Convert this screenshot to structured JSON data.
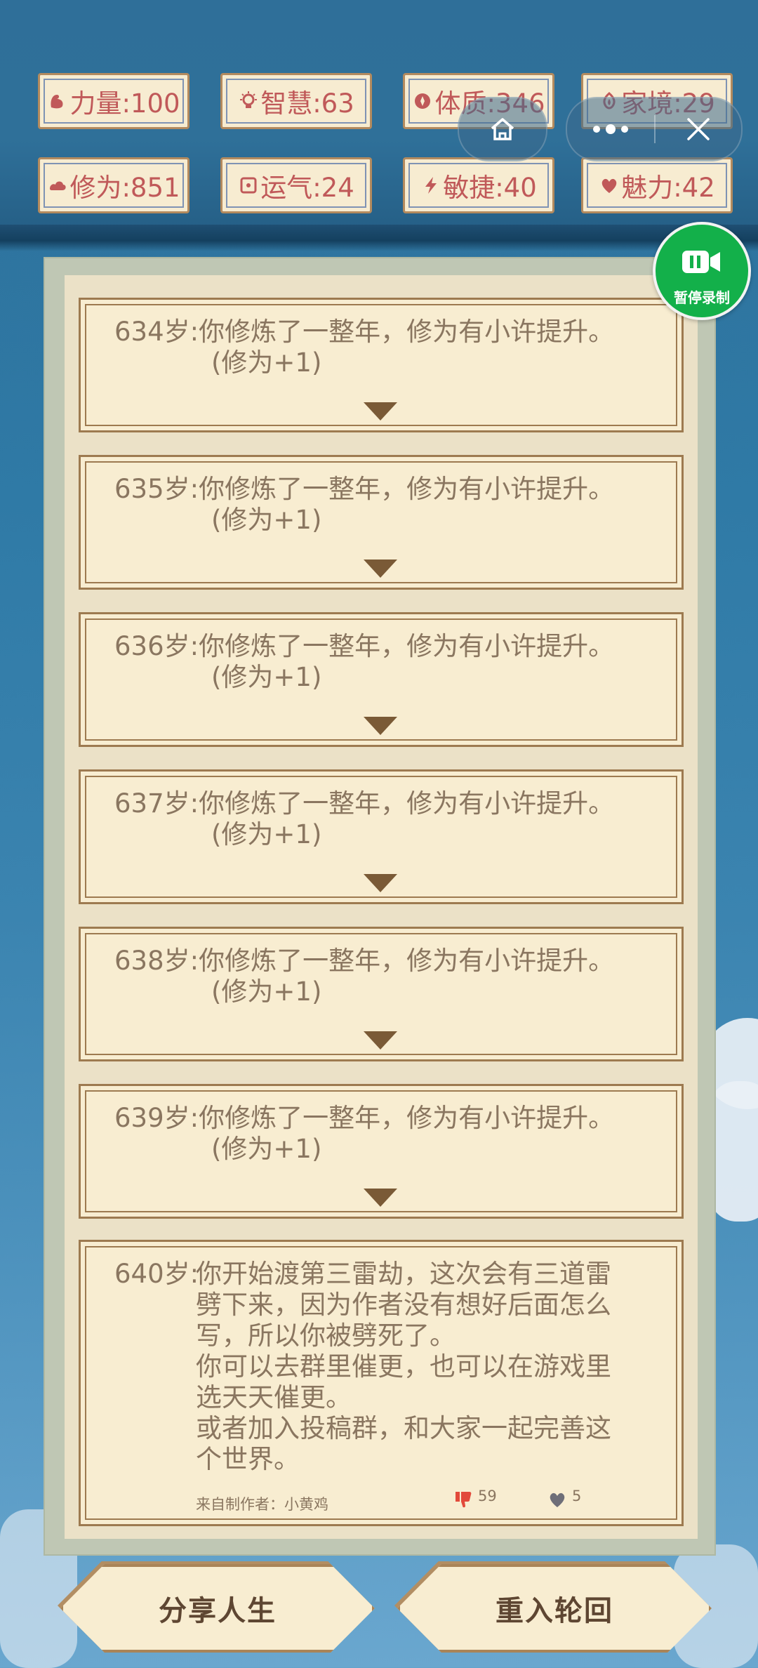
{
  "stats": [
    {
      "icon": "strength-icon",
      "label": "力量:100"
    },
    {
      "icon": "wisdom-icon",
      "label": "智慧:63"
    },
    {
      "icon": "constitution-icon",
      "label": "体质:346"
    },
    {
      "icon": "family-icon",
      "label": "家境:29"
    },
    {
      "icon": "cultivation-icon",
      "label": "修为:851"
    },
    {
      "icon": "luck-icon",
      "label": "运气:24"
    },
    {
      "icon": "agility-icon",
      "label": "敏捷:40"
    },
    {
      "icon": "charm-icon",
      "label": "魅力:42"
    }
  ],
  "mini_program": {
    "home_icon": "home-icon",
    "more_icon": "more-dots-icon",
    "close_icon": "close-icon"
  },
  "record_button": {
    "label": "暂停录制",
    "icon": "video-icon"
  },
  "events": [
    {
      "line1": "634岁:你修炼了一整年，修为有小许提升。",
      "line2": "(修为+1)"
    },
    {
      "line1": "635岁:你修炼了一整年，修为有小许提升。",
      "line2": "(修为+1)"
    },
    {
      "line1": "636岁:你修炼了一整年，修为有小许提升。",
      "line2": "(修为+1)"
    },
    {
      "line1": "637岁:你修炼了一整年，修为有小许提升。",
      "line2": "(修为+1)"
    },
    {
      "line1": "638岁:你修炼了一整年，修为有小许提升。",
      "line2": "(修为+1)"
    },
    {
      "line1": "639岁:你修炼了一整年，修为有小许提升。",
      "line2": "(修为+1)"
    }
  ],
  "final_event": {
    "age": "640岁:",
    "lines": [
      "你开始渡第三雷劫，这次会有三道雷",
      "劈下来，因为作者没有想好后面怎么",
      "写，所以你被劈死了。",
      "你可以去群里催更，也可以在游戏里",
      "选天天催更。",
      "或者加入投稿群，和大家一起完善这",
      "个世界。"
    ],
    "author": "来自制作者：小黄鸡",
    "dislikes": "59",
    "likes": "5"
  },
  "buttons": {
    "share": "分享人生",
    "restart": "重入轮回"
  },
  "colors": {
    "stat_text": "#c05959",
    "card_bg": "#f8edd1",
    "card_border": "#9d7a50",
    "body_text": "#8a7660",
    "record_green": "#13b04a"
  }
}
